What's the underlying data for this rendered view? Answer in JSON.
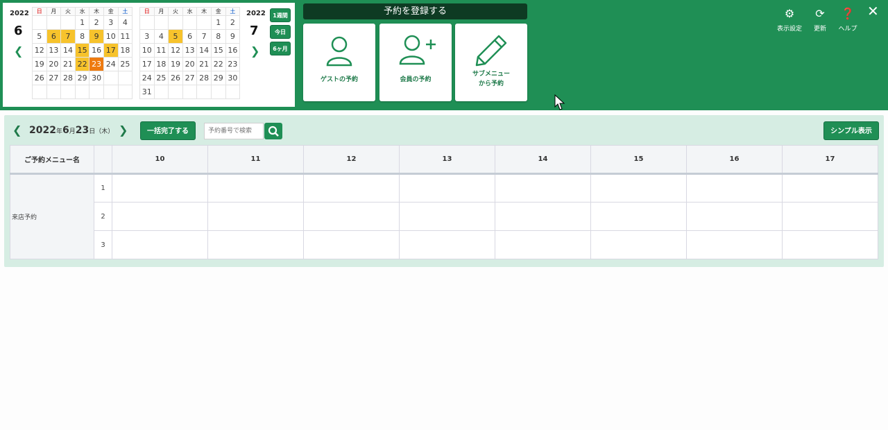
{
  "calendar": {
    "weekdays": [
      "日",
      "月",
      "火",
      "水",
      "木",
      "金",
      "土"
    ],
    "june": {
      "year": "2022",
      "month": "6",
      "weeks": [
        [
          "",
          "",
          "",
          "1",
          "2",
          "3",
          "4"
        ],
        [
          "5",
          "6",
          "7",
          "8",
          "9",
          "10",
          "11"
        ],
        [
          "12",
          "13",
          "14",
          "15",
          "16",
          "17",
          "18"
        ],
        [
          "19",
          "20",
          "21",
          "22",
          "23",
          "24",
          "25"
        ],
        [
          "26",
          "27",
          "28",
          "29",
          "30",
          "",
          ""
        ],
        [
          "",
          "",
          "",
          "",
          "",
          "",
          ""
        ]
      ],
      "highlighted": [
        "6",
        "7",
        "9",
        "15",
        "17",
        "22"
      ],
      "today": "23"
    },
    "july": {
      "year": "2022",
      "month": "7",
      "weeks": [
        [
          "",
          "",
          "",
          "",
          "",
          "1",
          "2"
        ],
        [
          "3",
          "4",
          "5",
          "6",
          "7",
          "8",
          "9"
        ],
        [
          "10",
          "11",
          "12",
          "13",
          "14",
          "15",
          "16"
        ],
        [
          "17",
          "18",
          "19",
          "20",
          "21",
          "22",
          "23"
        ],
        [
          "24",
          "25",
          "26",
          "27",
          "28",
          "29",
          "30"
        ],
        [
          "31",
          "",
          "",
          "",
          "",
          "",
          ""
        ]
      ],
      "highlighted": [
        "5"
      ],
      "today": ""
    },
    "range_buttons": [
      "1週間",
      "今日",
      "6ヶ月"
    ]
  },
  "register": {
    "title": "予約を登録する",
    "buttons": [
      {
        "label": "ゲストの予約",
        "icon": "person-icon"
      },
      {
        "label": "会員の予約",
        "icon": "person-add-icon"
      },
      {
        "label": "サブメニュー\nから予約",
        "icon": "pencil-icon"
      }
    ]
  },
  "toolbar": {
    "display_settings": "表示設定",
    "refresh": "更新",
    "help": "ヘルプ",
    "close": "✕"
  },
  "schedule": {
    "date_year": "2022",
    "date_year_suffix": "年",
    "date_month": "6",
    "date_month_suffix": "月",
    "date_day": "23",
    "date_day_suffix": "日",
    "date_weekday": "（木）",
    "complete_all_label": "一括完了する",
    "search_placeholder": "予約番号で検索",
    "simple_view_label": "シンプル表示",
    "menu_header": "ご予約メニュー名",
    "hours": [
      "10",
      "11",
      "12",
      "13",
      "14",
      "15",
      "16",
      "17"
    ],
    "menu_name": "来店予約",
    "rows": [
      "1",
      "2",
      "3"
    ]
  },
  "colors": {
    "brand_green": "#1f8f55",
    "highlight_yellow": "#f7c32c",
    "today_orange": "#ee7b10"
  }
}
